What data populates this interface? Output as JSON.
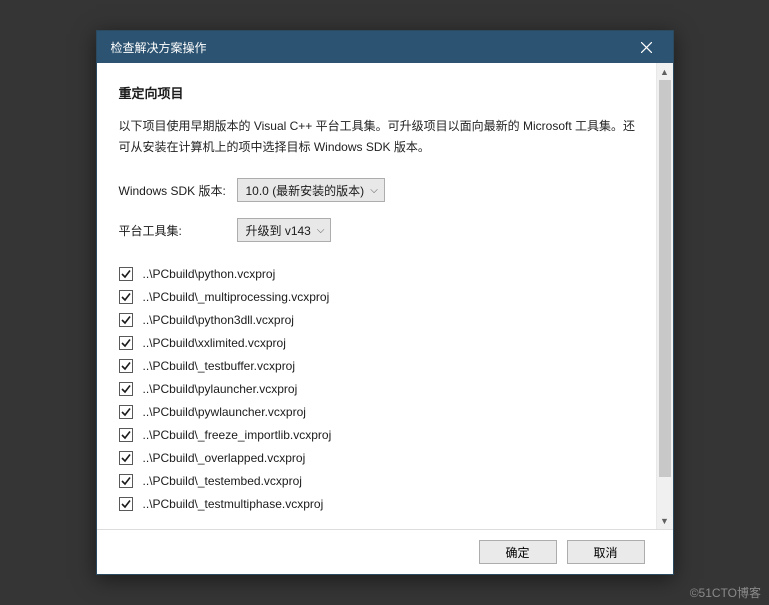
{
  "titlebar": {
    "title": "检查解决方案操作"
  },
  "content": {
    "heading": "重定向项目",
    "description": "以下项目使用早期版本的 Visual C++ 平台工具集。可升级项目以面向最新的 Microsoft 工具集。还可从安装在计算机上的项中选择目标 Windows SDK 版本。",
    "sdk_label": "Windows SDK 版本:",
    "sdk_value": "10.0 (最新安装的版本)",
    "toolset_label": "平台工具集:",
    "toolset_value": "升级到 v143"
  },
  "projects": [
    {
      "checked": true,
      "path": "..\\PCbuild\\python.vcxproj"
    },
    {
      "checked": true,
      "path": "..\\PCbuild\\_multiprocessing.vcxproj"
    },
    {
      "checked": true,
      "path": "..\\PCbuild\\python3dll.vcxproj"
    },
    {
      "checked": true,
      "path": "..\\PCbuild\\xxlimited.vcxproj"
    },
    {
      "checked": true,
      "path": "..\\PCbuild\\_testbuffer.vcxproj"
    },
    {
      "checked": true,
      "path": "..\\PCbuild\\pylauncher.vcxproj"
    },
    {
      "checked": true,
      "path": "..\\PCbuild\\pywlauncher.vcxproj"
    },
    {
      "checked": true,
      "path": "..\\PCbuild\\_freeze_importlib.vcxproj"
    },
    {
      "checked": true,
      "path": "..\\PCbuild\\_overlapped.vcxproj"
    },
    {
      "checked": true,
      "path": "..\\PCbuild\\_testembed.vcxproj"
    },
    {
      "checked": true,
      "path": "..\\PCbuild\\_testmultiphase.vcxproj"
    }
  ],
  "footer": {
    "ok": "确定",
    "cancel": "取消"
  },
  "watermark": "©51CTO博客"
}
